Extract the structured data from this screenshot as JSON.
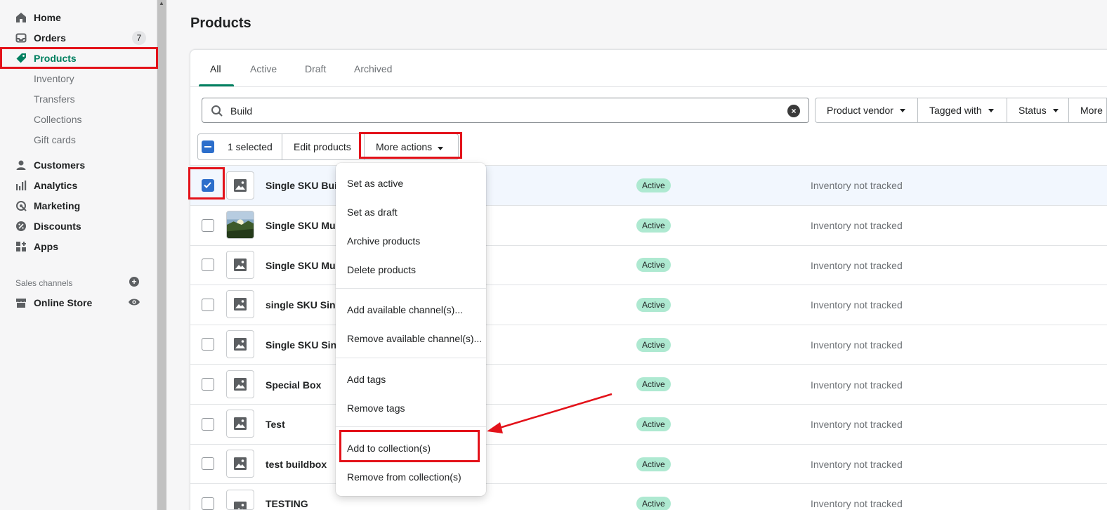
{
  "sidebar": {
    "items": [
      {
        "label": "Home",
        "icon": "home-icon"
      },
      {
        "label": "Orders",
        "icon": "inbox-icon",
        "count": "7"
      },
      {
        "label": "Products",
        "icon": "tag-icon"
      },
      {
        "label": "Inventory"
      },
      {
        "label": "Transfers"
      },
      {
        "label": "Collections"
      },
      {
        "label": "Gift cards"
      },
      {
        "label": "Customers",
        "icon": "person-icon"
      },
      {
        "label": "Analytics",
        "icon": "bar-chart-icon"
      },
      {
        "label": "Marketing",
        "icon": "target-icon"
      },
      {
        "label": "Discounts",
        "icon": "discount-icon"
      },
      {
        "label": "Apps",
        "icon": "apps-icon"
      }
    ],
    "sales_channels_title": "Sales channels",
    "online_store": "Online Store"
  },
  "main": {
    "title": "Products",
    "tabs": [
      "All",
      "Active",
      "Draft",
      "Archived"
    ],
    "search_value": "Build",
    "filters": [
      "Product vendor",
      "Tagged with",
      "Status",
      "More"
    ],
    "bulk": {
      "selected": "1 selected",
      "edit": "Edit products",
      "more": "More actions"
    },
    "rows": [
      {
        "name": "Single SKU Build",
        "status": "Active",
        "inventory": "Inventory not tracked",
        "checked": true
      },
      {
        "name": "Single SKU Mult",
        "status": "Active",
        "inventory": "Inventory not tracked",
        "photo": true
      },
      {
        "name": "Single SKU Mult",
        "status": "Active",
        "inventory": "Inventory not tracked"
      },
      {
        "name": "single SKU Sing",
        "status": "Active",
        "inventory": "Inventory not tracked"
      },
      {
        "name": "Single SKU Sing",
        "status": "Active",
        "inventory": "Inventory not tracked"
      },
      {
        "name": "Special Box",
        "status": "Active",
        "inventory": "Inventory not tracked"
      },
      {
        "name": "Test",
        "status": "Active",
        "inventory": "Inventory not tracked"
      },
      {
        "name": "test buildbox",
        "status": "Active",
        "inventory": "Inventory not tracked"
      },
      {
        "name": "TESTING",
        "status": "Active",
        "inventory": "Inventory not tracked"
      }
    ]
  },
  "dropdown": {
    "groups": [
      [
        "Set as active",
        "Set as draft",
        "Archive products",
        "Delete products"
      ],
      [
        "Add available channel(s)...",
        "Remove available channel(s)..."
      ],
      [
        "Add tags",
        "Remove tags"
      ],
      [
        "Add to collection(s)",
        "Remove from collection(s)"
      ]
    ]
  },
  "colors": {
    "accent": "#008060",
    "highlight": "#e3121a",
    "checkbox": "#2c6ecb",
    "status_bg": "#aee9d1"
  }
}
